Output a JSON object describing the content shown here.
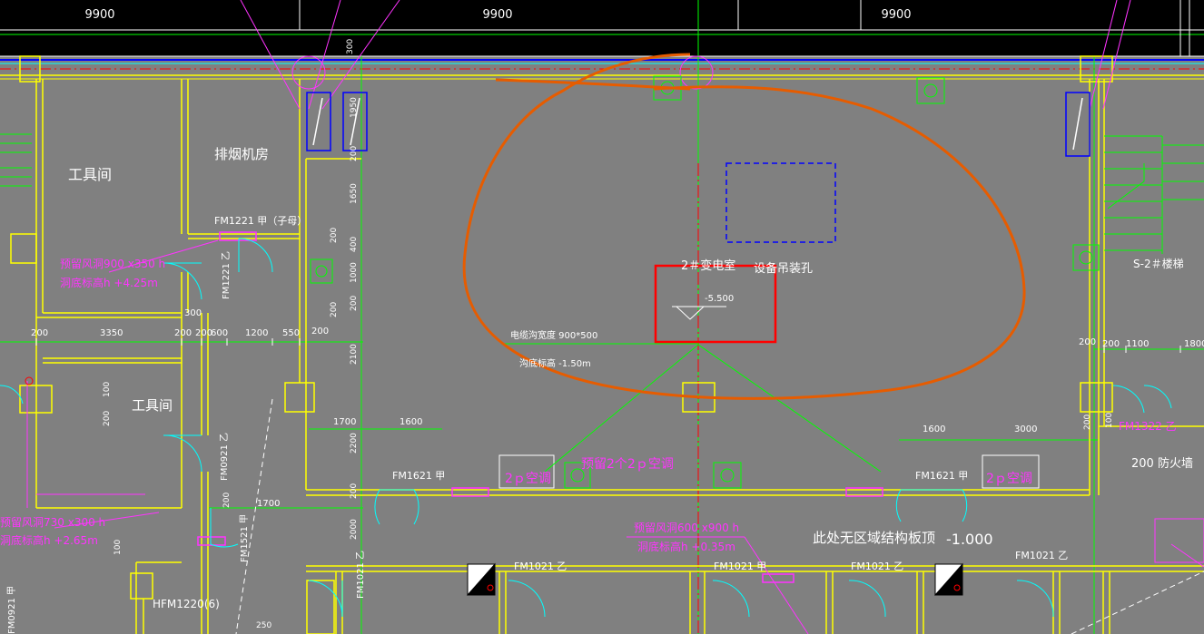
{
  "dimensions_top": [
    "9900",
    "9900",
    "9900"
  ],
  "rooms": {
    "tool_room_1": "工具间",
    "tool_room_2": "工具间",
    "exhaust_room": "排烟机房",
    "substation": "2＃变电室",
    "equipment_hole": "设备吊装孔",
    "stair": "S-2＃楼梯",
    "area_note": "此处无区域结构板顶",
    "fire_wall": "200 防火墙"
  },
  "doors": {
    "fm1221": "FM1221 甲（子母）",
    "fm1221_v": "FM1221 乙",
    "fm0921_v": "FM0921 乙",
    "fm1521_v": "FM1521 甲",
    "fm1621_a": "FM1621 甲",
    "fm1621_b": "FM1621 甲",
    "fm1322": "FM1322 乙",
    "fm1021_1": "FM1021 乙",
    "fm1021_2": "FM1021 乙",
    "fm1021_3": "FM1021 甲",
    "fm1021_4": "FM1021 乙",
    "fm1021_5": "FM1021 乙",
    "fm0921_bl": "FM0921 甲",
    "hfm1220": "HFM1220(6)"
  },
  "annotations": {
    "duct1_size": "预留风洞900 x350 h",
    "duct1_level": "洞底标高h +4.25m",
    "duct2_size": "预留风洞730 x300 h",
    "duct2_level": "洞底标高h +2.65m",
    "duct3_size": "预留风洞600 x900 h",
    "duct3_level": "洞底标高h +0.35m",
    "trench_size": "电缆沟宽度  900*500",
    "trench_level": "沟底标高  -1.50m",
    "ac_1": "2ｐ空调",
    "ac_2": "2ｐ空调",
    "ac_3": "预留2个2ｐ空调",
    "elev": "-5.500",
    "elev2": "-1.000",
    "wall_note": "200 防火墙"
  },
  "dims": {
    "d200a": "200",
    "d3350": "3350",
    "d200b": "200",
    "d200c": "200",
    "d600": "600",
    "d1200": "1200",
    "d550": "550",
    "d200d": "200",
    "d300": "300",
    "d1700a": "1700",
    "d1600a": "1600",
    "d1700b": "1700",
    "d1600b": "1600",
    "d3000": "3000",
    "d200e": "200",
    "d200f": "200",
    "d1100": "1100",
    "d1800": "1800",
    "v300": "300",
    "v1950": "1950",
    "v200a": "200",
    "v1650": "1650",
    "v200b": "200",
    "v400": "400",
    "v1000": "1000",
    "v200c": "200",
    "v2100": "2100",
    "v200d": "200",
    "v2200": "2200",
    "v200e": "200",
    "v2000": "2000",
    "v100a": "100",
    "v200f": "200",
    "v100b": "100",
    "v250": "250",
    "v200g": "200",
    "v200h": "200",
    "v100c": "100"
  },
  "colors": {
    "background": "#808080",
    "wall": "#ffff00",
    "axis": "#00ff00",
    "magenta": "#ff33ff",
    "cyan": "#00ffff",
    "blue": "#0000ff",
    "red": "#ff0000",
    "markup_orange": "#e65c00",
    "markup_red": "#ff0000"
  }
}
